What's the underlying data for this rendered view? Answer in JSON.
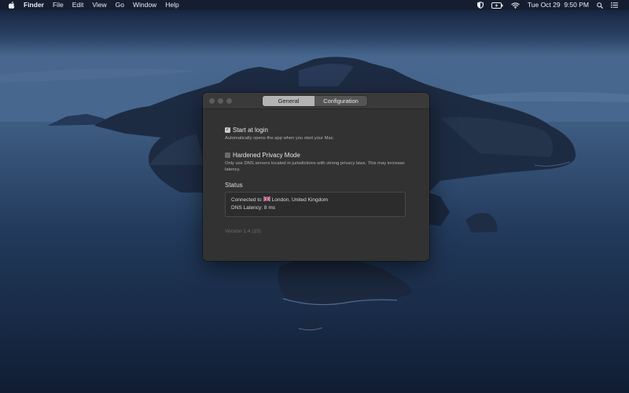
{
  "menubar": {
    "apple_icon": "apple-icon",
    "app_name": "Finder",
    "menus": [
      "File",
      "Edit",
      "View",
      "Go",
      "Window",
      "Help"
    ],
    "status_icons": [
      "shield-icon",
      "battery-icon",
      "wifi-icon"
    ],
    "clock": "Tue Oct 29  9:50 PM",
    "right_icons": [
      "spotlight-search-icon",
      "notification-center-icon"
    ]
  },
  "window": {
    "tabs": [
      "General",
      "Configuration"
    ],
    "selected_tab": "General",
    "start_at_login": {
      "label": "Start at login",
      "checked": true,
      "description": "Automatically opens the app when you start your Mac."
    },
    "hardened_privacy": {
      "label": "Hardened Privacy Mode",
      "checked": false,
      "description": "Only use DNS servers located in jurisdictions with strong privacy laws. This may increase latency."
    },
    "status": {
      "title": "Status",
      "connected_prefix": "Connected to",
      "flag_icon": "uk-flag-icon",
      "location": "London, United Kingdom",
      "latency": "DNS Latency: 8 ms"
    },
    "version": "Version 1.4 (15)"
  },
  "colors": {
    "window_bg": "#323232",
    "menubar_bg": "#161e30",
    "selected_segment": "#b3b3b3"
  }
}
